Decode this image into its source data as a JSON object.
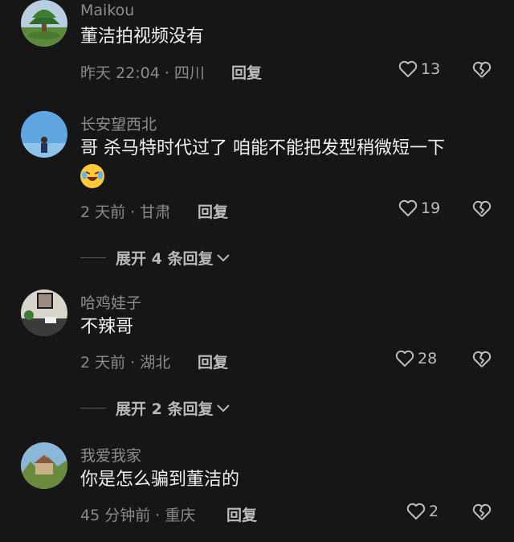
{
  "comments": [
    {
      "username": "Maikou",
      "text": "董洁拍视频没有",
      "meta": "昨天 22:04 · 四川",
      "reply_label": "回复",
      "likes": "13"
    },
    {
      "username": "长安望西北",
      "text": "哥 杀马特时代过了 咱能不能把发型稍微短一下",
      "meta": "2 天前 · 甘肃",
      "reply_label": "回复",
      "likes": "19",
      "expand_label": "展开 4 条回复"
    },
    {
      "username": "哈鸡娃子",
      "text": "不辣哥",
      "meta": "2 天前 · 湖北",
      "reply_label": "回复",
      "likes": "28",
      "expand_label": "展开 2 条回复"
    },
    {
      "username": "我爱我家",
      "text": "你是怎么骗到董洁的",
      "meta": "45 分钟前 · 重庆",
      "reply_label": "回复",
      "likes": "2"
    }
  ],
  "icons": {
    "like": "heart-outline-icon",
    "dislike": "broken-heart-icon",
    "expand": "chevron-down-icon",
    "emoji": "laughing-tears-emoji-icon"
  },
  "colors": {
    "background": "#161616",
    "username": "#8d8d8d",
    "text": "#efefef",
    "meta": "#8a8a8a"
  }
}
